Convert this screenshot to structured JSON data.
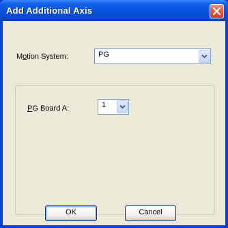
{
  "dialog": {
    "title": "Add Additional Axis",
    "close_icon": "close-icon"
  },
  "form": {
    "motion_system": {
      "label_prefix": "M",
      "label_accel": "o",
      "label_rest": "tion System:",
      "value": "PG"
    },
    "pg_board": {
      "label_accel": "P",
      "label_rest": "G Board A:",
      "value": "1"
    }
  },
  "buttons": {
    "ok": "OK",
    "cancel": "Cancel"
  }
}
